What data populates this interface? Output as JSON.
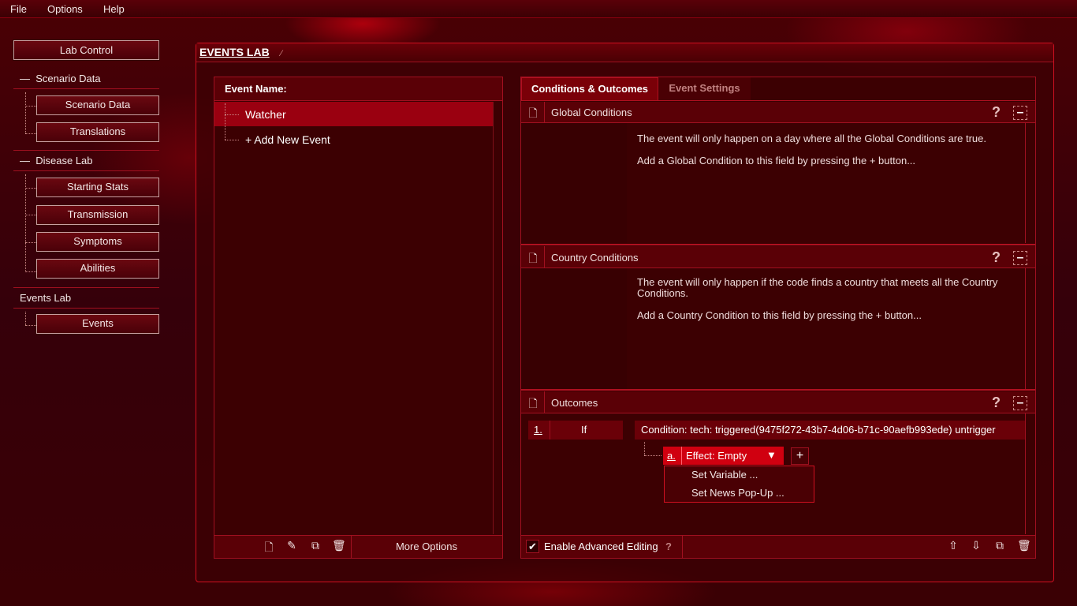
{
  "menu": {
    "file": "File",
    "options": "Options",
    "help": "Help"
  },
  "sidebar": {
    "lab_control": "Lab Control",
    "scenario_data_header": "Scenario Data",
    "scenario_data": "Scenario Data",
    "translations": "Translations",
    "disease_lab_header": "Disease Lab",
    "starting_stats": "Starting Stats",
    "transmission": "Transmission",
    "symptoms": "Symptoms",
    "abilities": "Abilities",
    "events_lab_header": "Events Lab",
    "events": "Events"
  },
  "main": {
    "title": "EVENTS LAB",
    "event_list": {
      "header": "Event Name:",
      "items": [
        "Watcher",
        "+ Add New Event"
      ],
      "more_options": "More Options"
    },
    "tabs": [
      "Conditions & Outcomes",
      "Event Settings"
    ],
    "global": {
      "title": "Global Conditions",
      "line1": "The event will only happen on a day where all the Global Conditions are true.",
      "line2": "Add a Global Condition to this field by pressing the + button..."
    },
    "country": {
      "title": "Country Conditions",
      "line1": "The event will only happen if the code finds a country that meets all the Country Conditions.",
      "line2": "Add a Country Condition to this field by pressing the + button..."
    },
    "outcomes": {
      "title": "Outcomes",
      "num": "1.",
      "if": "If",
      "condition": "Condition:  tech: triggered(9475f272-43b7-4d06-b71c-90aefb993ede) untrigger",
      "effect_letter": "a.",
      "effect": "Effect:  Empty",
      "add": "+",
      "dropdown": [
        "Set Variable ...",
        "Set News Pop-Up ..."
      ]
    },
    "advanced": "Enable Advanced Editing",
    "help": "?"
  }
}
